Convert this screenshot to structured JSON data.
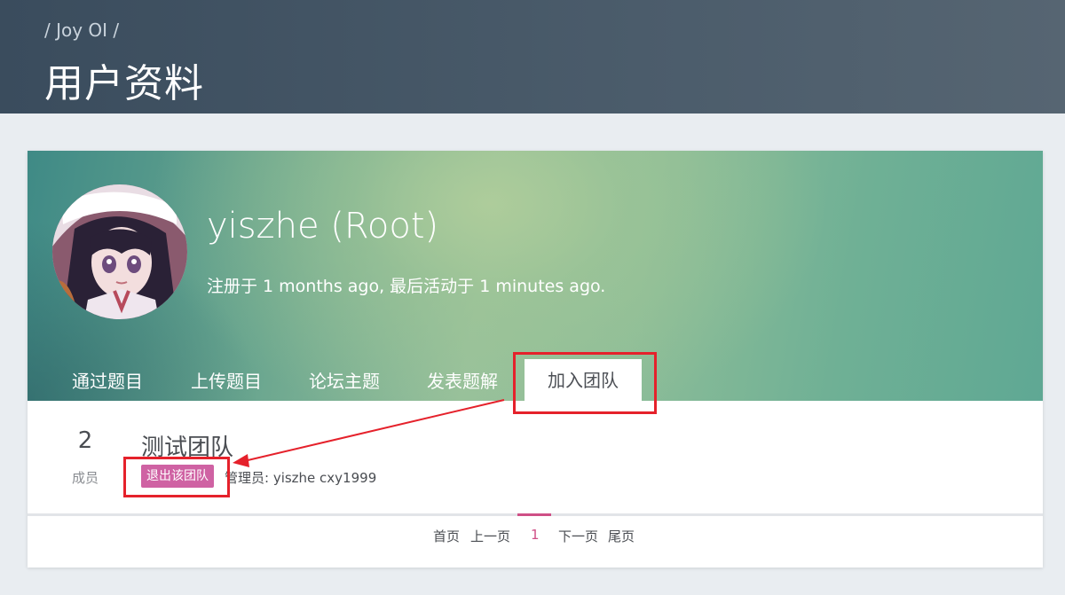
{
  "header": {
    "breadcrumb": "/ Joy OI /",
    "title": "用户资料"
  },
  "profile": {
    "username": "yiszhe (Root)",
    "registered_line": "注册于 1 months ago, 最后活动于 1 minutes ago.",
    "avatar_icon": "anime-avatar-image"
  },
  "tabs": [
    {
      "label": "通过题目",
      "active": false
    },
    {
      "label": "上传题目",
      "active": false
    },
    {
      "label": "论坛主题",
      "active": false
    },
    {
      "label": "发表题解",
      "active": false
    },
    {
      "label": "加入团队",
      "active": true
    }
  ],
  "team": {
    "member_count": "2",
    "member_label": "成员",
    "name": "测试团队",
    "leave_button": "退出该团队",
    "admins": "管理员: yiszhe cxy1999"
  },
  "pagination": {
    "first": "首页",
    "prev": "上一页",
    "current": "1",
    "next": "下一页",
    "last": "尾页"
  },
  "colors": {
    "accent": "#cf62a3",
    "annotation": "#e5212b"
  }
}
